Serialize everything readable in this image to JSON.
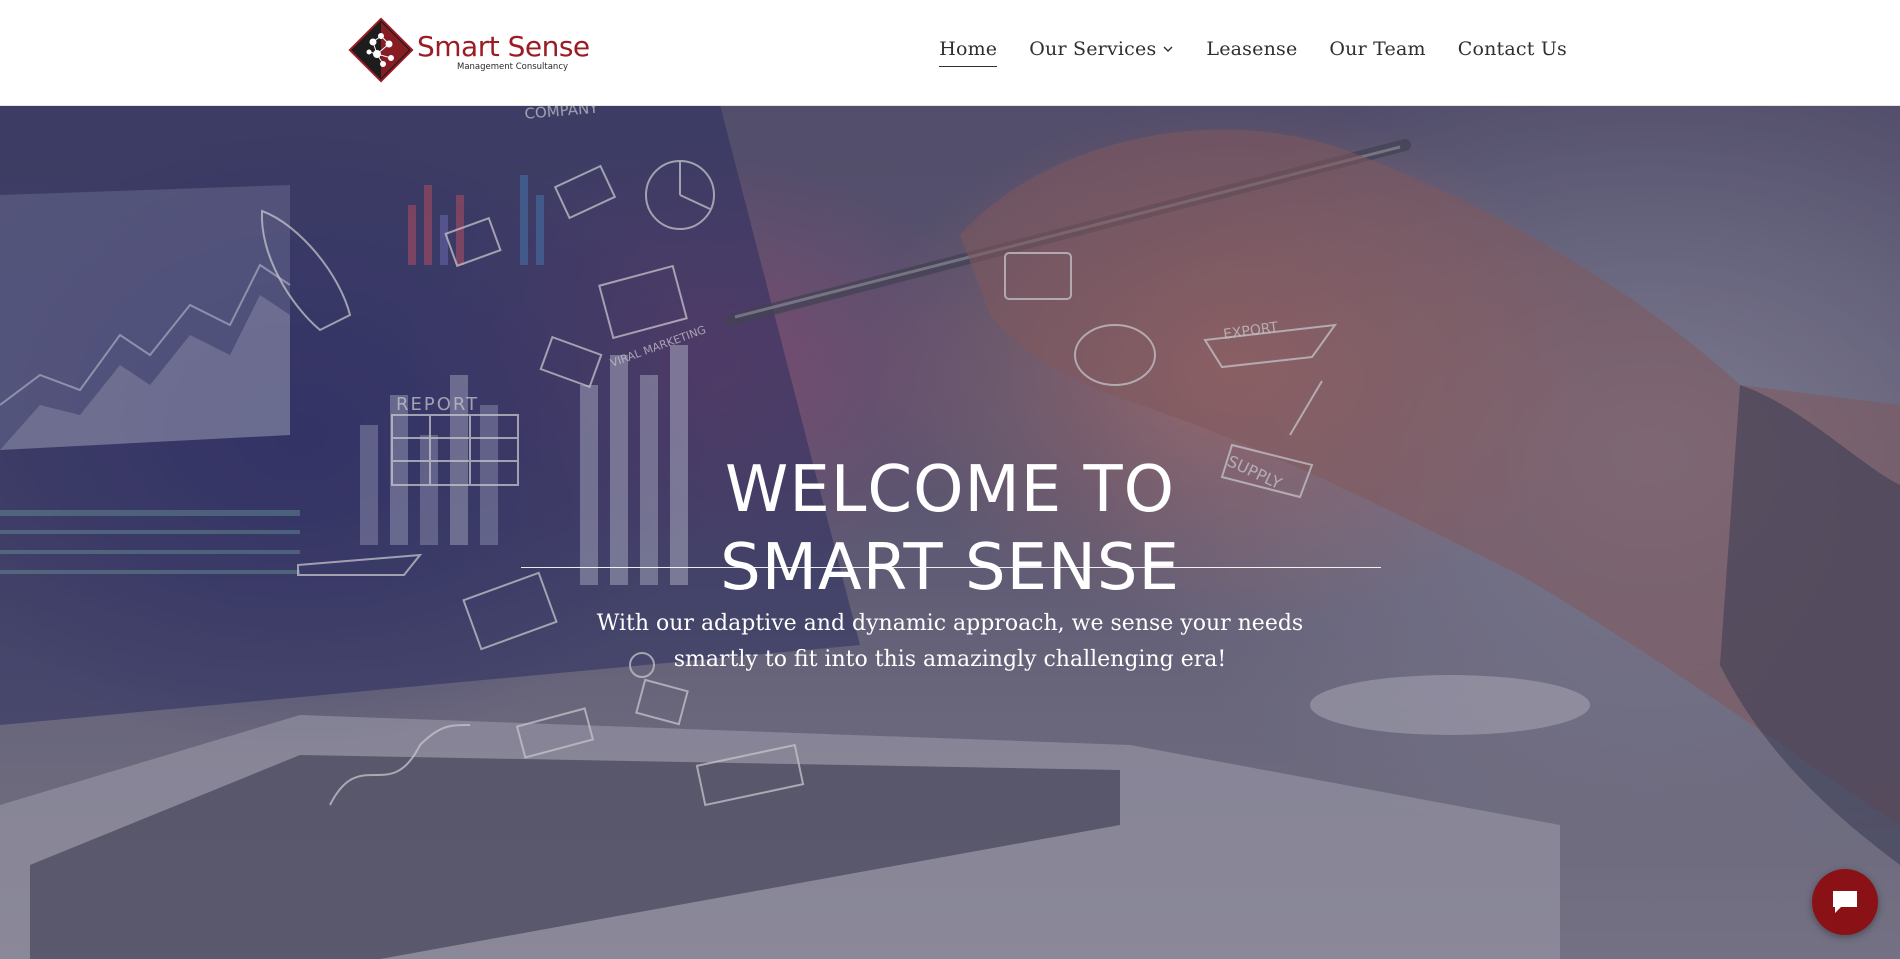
{
  "header": {
    "logo": {
      "title": "Smart Sense",
      "subtitle": "Management Consultancy",
      "icon": "logo-diamond-icon"
    },
    "nav": [
      {
        "label": "Home",
        "active": true
      },
      {
        "label": "Our Services",
        "has_dropdown": true,
        "icon": "chevron-down-icon"
      },
      {
        "label": "Leasense"
      },
      {
        "label": "Our Team"
      },
      {
        "label": "Contact Us"
      }
    ]
  },
  "hero": {
    "title_line1": "WELCOME TO",
    "title_line2": "SMART SENSE",
    "subtitle": "With our adaptive and dynamic approach, we sense your needs smartly to fit into this amazingly challenging era!",
    "background_icons": {
      "report": "REPORT",
      "viral_marketing": "VIRAL MARKETING",
      "export": "EXPORT",
      "supply": "SUPPLY",
      "company": "COMPANY"
    }
  },
  "chat": {
    "icon": "chat-bubble-icon"
  },
  "colors": {
    "brand": "#9b1c24",
    "chat_button": "#8a1216",
    "nav_text": "#2f2f2f",
    "hero_text": "#ffffff"
  }
}
